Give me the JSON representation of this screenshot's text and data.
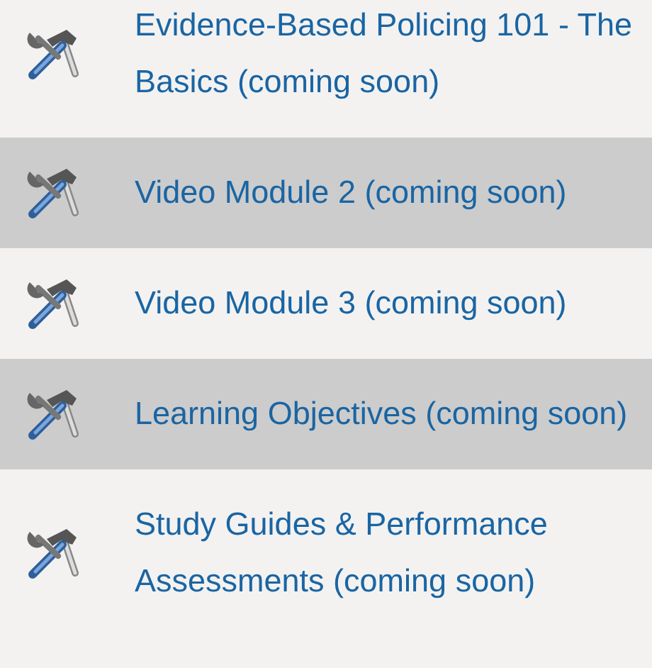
{
  "items": [
    {
      "label": "Evidence-Based Policing 101 - The Basics (coming soon)"
    },
    {
      "label": "Video Module 2 (coming soon)"
    },
    {
      "label": "Video Module 3 (coming soon)"
    },
    {
      "label": "Learning Objectives (coming soon)"
    },
    {
      "label": "Study Guides & Performance Assessments (coming soon)"
    }
  ]
}
